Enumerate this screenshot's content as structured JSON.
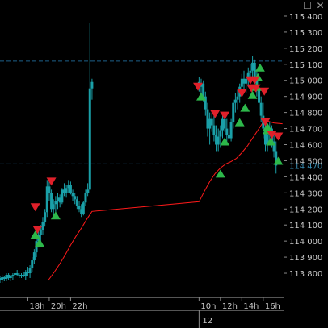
{
  "window": {
    "minimize_symbol": "—",
    "maximize_symbol": "☐",
    "close_symbol": "✕"
  },
  "colors": {
    "background": "#000000",
    "candle": "#1aa0a8",
    "moving_average": "#ff1a1a",
    "level_line": "#1c5f8a",
    "arrow_up": "#2db84a",
    "arrow_down": "#e0202a",
    "price_tag": "#3a8fb5",
    "axis": "#8a8a8a",
    "text": "#c8c8c8"
  },
  "chart_data": {
    "type": "candlestick",
    "title": "",
    "y_ticks": [
      "115 400",
      "115 300",
      "115 200",
      "115 100",
      "115 000",
      "114 900",
      "114 800",
      "114 700",
      "114 600",
      "114 500",
      "114 400",
      "114 300",
      "114 200",
      "114 100",
      "114 000",
      "113 900",
      "113 800"
    ],
    "ylim": [
      113760,
      115430
    ],
    "x_ticks": [
      "18h",
      "20h",
      "22h",
      "10h",
      "12h",
      "14h",
      "16h"
    ],
    "x_tick_hours": [
      18,
      20,
      22,
      34,
      36,
      38,
      40
    ],
    "xlim_hours": [
      15.4,
      41.9
    ],
    "date_marker": {
      "label": "12",
      "hour": 34
    },
    "current_price": {
      "value": 114470,
      "label": "114 470"
    },
    "level_lines": [
      115120,
      114480
    ],
    "candles": [
      [
        15.4,
        113770,
        113780,
        113740,
        113760
      ],
      [
        15.6,
        113760,
        113790,
        113740,
        113775
      ],
      [
        15.8,
        113775,
        113785,
        113750,
        113765
      ],
      [
        16.0,
        113765,
        113800,
        113750,
        113790
      ],
      [
        16.2,
        113790,
        113800,
        113760,
        113770
      ],
      [
        16.4,
        113770,
        113790,
        113750,
        113780
      ],
      [
        16.6,
        113780,
        113800,
        113760,
        113790
      ],
      [
        16.8,
        113790,
        113810,
        113770,
        113800
      ],
      [
        17.0,
        113800,
        113820,
        113780,
        113790
      ],
      [
        17.2,
        113790,
        113800,
        113770,
        113785
      ],
      [
        17.4,
        113785,
        113800,
        113770,
        113790
      ],
      [
        17.6,
        113790,
        113805,
        113775,
        113780
      ],
      [
        17.8,
        113780,
        113820,
        113760,
        113810
      ],
      [
        18.0,
        113810,
        113840,
        113780,
        113800
      ],
      [
        18.2,
        113800,
        113850,
        113770,
        113830
      ],
      [
        18.4,
        113830,
        113900,
        113810,
        113880
      ],
      [
        18.6,
        113880,
        113950,
        113860,
        113930
      ],
      [
        18.8,
        113930,
        114020,
        113900,
        114000
      ],
      [
        19.0,
        114000,
        114060,
        113960,
        114040
      ],
      [
        19.2,
        114040,
        114100,
        113990,
        114070
      ],
      [
        19.4,
        114070,
        114150,
        114040,
        114120
      ],
      [
        19.6,
        114120,
        114200,
        114090,
        114180
      ],
      [
        19.8,
        114180,
        114380,
        114150,
        114340
      ],
      [
        20.0,
        114340,
        114390,
        114250,
        114300
      ],
      [
        20.2,
        114300,
        114320,
        114180,
        114200
      ],
      [
        20.4,
        114200,
        114260,
        114160,
        114230
      ],
      [
        20.6,
        114230,
        114280,
        114180,
        114250
      ],
      [
        20.8,
        114250,
        114300,
        114200,
        114270
      ],
      [
        21.0,
        114270,
        114290,
        114210,
        114240
      ],
      [
        21.2,
        114240,
        114330,
        114230,
        114320
      ],
      [
        21.4,
        114320,
        114360,
        114280,
        114300
      ],
      [
        21.6,
        114300,
        114350,
        114270,
        114330
      ],
      [
        21.8,
        114330,
        114380,
        114300,
        114350
      ],
      [
        22.0,
        114350,
        114370,
        114290,
        114300
      ],
      [
        22.2,
        114300,
        114320,
        114250,
        114280
      ],
      [
        22.4,
        114280,
        114300,
        114230,
        114260
      ],
      [
        22.6,
        114260,
        114280,
        114200,
        114220
      ],
      [
        22.8,
        114220,
        114250,
        114180,
        114200
      ],
      [
        23.0,
        114200,
        114230,
        114150,
        114170
      ],
      [
        23.2,
        114170,
        114250,
        114160,
        114240
      ],
      [
        23.4,
        114240,
        114320,
        114220,
        114300
      ],
      [
        23.6,
        114300,
        114360,
        114280,
        114320
      ],
      [
        23.8,
        114320,
        115360,
        114300,
        114950
      ],
      [
        24.0,
        114950,
        115010,
        114880,
        114990
      ],
      [
        34.0,
        114990,
        115020,
        114930,
        114960
      ],
      [
        34.2,
        114960,
        115010,
        114900,
        114980
      ],
      [
        34.4,
        114980,
        115000,
        114870,
        114900
      ],
      [
        34.6,
        114900,
        114930,
        114780,
        114820
      ],
      [
        34.8,
        114820,
        114860,
        114650,
        114700
      ],
      [
        35.0,
        114700,
        114800,
        114600,
        114760
      ],
      [
        35.2,
        114760,
        114800,
        114680,
        114720
      ],
      [
        35.4,
        114720,
        114780,
        114620,
        114660
      ],
      [
        35.6,
        114660,
        114720,
        114560,
        114600
      ],
      [
        35.8,
        114600,
        114700,
        114560,
        114650
      ],
      [
        36.0,
        114650,
        114720,
        114580,
        114690
      ],
      [
        36.2,
        114690,
        114800,
        114640,
        114760
      ],
      [
        36.4,
        114760,
        114800,
        114680,
        114700
      ],
      [
        36.6,
        114700,
        114760,
        114620,
        114660
      ],
      [
        36.8,
        114660,
        114720,
        114600,
        114640
      ],
      [
        37.0,
        114640,
        114760,
        114620,
        114740
      ],
      [
        37.2,
        114740,
        114880,
        114700,
        114860
      ],
      [
        37.4,
        114860,
        114920,
        114800,
        114880
      ],
      [
        37.6,
        114880,
        114940,
        114820,
        114900
      ],
      [
        37.8,
        114900,
        114980,
        114860,
        114960
      ],
      [
        38.0,
        114960,
        115040,
        114900,
        115010
      ],
      [
        38.2,
        115010,
        115060,
        114940,
        114980
      ],
      [
        38.4,
        114980,
        115040,
        114920,
        115010
      ],
      [
        38.6,
        115010,
        115080,
        114960,
        115050
      ],
      [
        38.8,
        115050,
        115100,
        115000,
        115060
      ],
      [
        39.0,
        115060,
        115150,
        115020,
        115110
      ],
      [
        39.2,
        115110,
        115130,
        115000,
        115020
      ],
      [
        39.4,
        115020,
        115060,
        114900,
        114950
      ],
      [
        39.6,
        114950,
        114980,
        114820,
        114860
      ],
      [
        39.8,
        114860,
        114900,
        114740,
        114780
      ],
      [
        40.0,
        114780,
        114860,
        114640,
        114700
      ],
      [
        40.2,
        114700,
        114760,
        114560,
        114600
      ],
      [
        40.4,
        114600,
        114700,
        114560,
        114660
      ],
      [
        40.6,
        114660,
        114740,
        114600,
        114700
      ],
      [
        40.8,
        114700,
        114720,
        114580,
        114620
      ],
      [
        41.0,
        114620,
        114680,
        114520,
        114560
      ],
      [
        41.2,
        114560,
        114620,
        114420,
        114470
      ]
    ],
    "moving_average": {
      "x": [
        19.9,
        20.5,
        21.0,
        21.5,
        22.0,
        22.5,
        23.0,
        23.5,
        24.0,
        34.0,
        34.5,
        35.0,
        35.5,
        36.0,
        36.5,
        37.0,
        37.5,
        38.0,
        38.5,
        39.0,
        39.5,
        40.0,
        40.5,
        41.0,
        41.8
      ],
      "y": [
        113755,
        113810,
        113860,
        113915,
        113975,
        114030,
        114080,
        114135,
        114185,
        114245,
        114310,
        114370,
        114420,
        114455,
        114480,
        114495,
        114515,
        114550,
        114590,
        114640,
        114690,
        114740,
        114745,
        114735,
        114730
      ]
    },
    "signals": [
      {
        "dir": "down",
        "hour": 18.7,
        "price": 114210
      },
      {
        "dir": "up",
        "hour": 18.7,
        "price": 114040
      },
      {
        "dir": "down",
        "hour": 18.9,
        "price": 114070
      },
      {
        "dir": "up",
        "hour": 19.1,
        "price": 113990
      },
      {
        "dir": "down",
        "hour": 20.2,
        "price": 114370
      },
      {
        "dir": "up",
        "hour": 20.6,
        "price": 114160
      },
      {
        "dir": "down",
        "hour": 33.9,
        "price": 114960
      },
      {
        "dir": "up",
        "hour": 34.2,
        "price": 114900
      },
      {
        "dir": "down",
        "hour": 35.5,
        "price": 114790
      },
      {
        "dir": "down",
        "hour": 36.4,
        "price": 114780
      },
      {
        "dir": "up",
        "hour": 36.4,
        "price": 114620
      },
      {
        "dir": "up",
        "hour": 36.0,
        "price": 114420
      },
      {
        "dir": "up",
        "hour": 37.8,
        "price": 114740
      },
      {
        "dir": "up",
        "hour": 38.3,
        "price": 114830
      },
      {
        "dir": "down",
        "hour": 38.0,
        "price": 114920
      },
      {
        "dir": "down",
        "hour": 38.8,
        "price": 115000
      },
      {
        "dir": "down",
        "hour": 38.9,
        "price": 114950
      },
      {
        "dir": "up",
        "hour": 39.0,
        "price": 114910
      },
      {
        "dir": "up",
        "hour": 39.4,
        "price": 114960
      },
      {
        "dir": "up",
        "hour": 39.5,
        "price": 115020
      },
      {
        "dir": "down",
        "hour": 39.2,
        "price": 115000
      },
      {
        "dir": "down",
        "hour": 39.3,
        "price": 114950
      },
      {
        "dir": "up",
        "hour": 39.7,
        "price": 115080
      },
      {
        "dir": "down",
        "hour": 40.1,
        "price": 114930
      },
      {
        "dir": "down",
        "hour": 40.2,
        "price": 114740
      },
      {
        "dir": "up",
        "hour": 40.4,
        "price": 114710
      },
      {
        "dir": "up",
        "hour": 40.4,
        "price": 114690
      },
      {
        "dir": "down",
        "hour": 40.8,
        "price": 114660
      },
      {
        "dir": "up",
        "hour": 40.7,
        "price": 114620
      },
      {
        "dir": "down",
        "hour": 41.4,
        "price": 114650
      },
      {
        "dir": "up",
        "hour": 41.4,
        "price": 114500
      }
    ]
  }
}
